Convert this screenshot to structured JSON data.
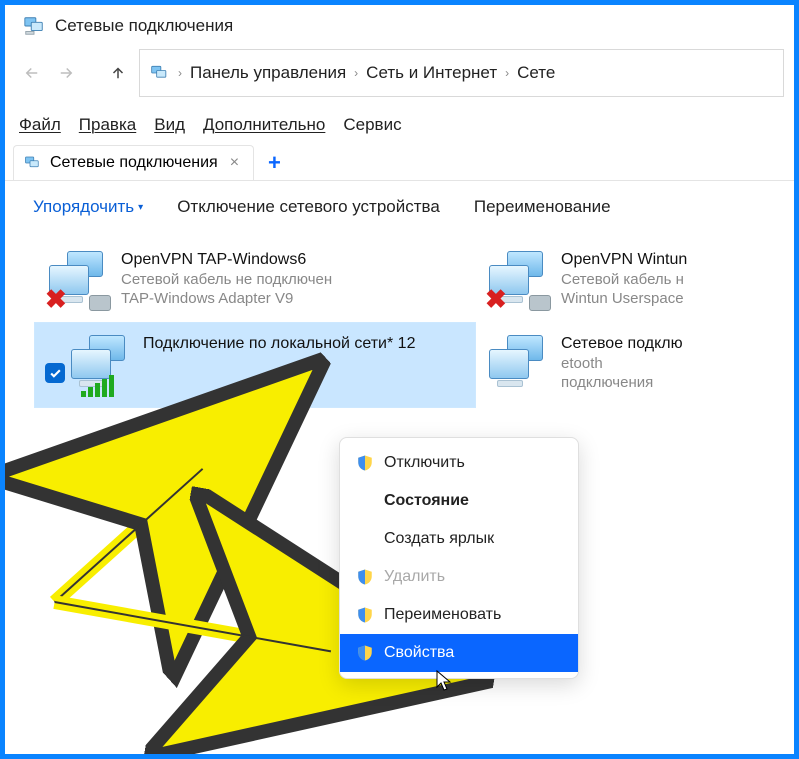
{
  "window": {
    "title": "Сетевые подключения"
  },
  "nav": {
    "breadcrumb": [
      "Панель управления",
      "Сеть и Интернет",
      "Сете"
    ]
  },
  "menubar": {
    "file": "Файл",
    "edit": "Правка",
    "view": "Вид",
    "extra": "Дополнительно",
    "service": "Сервис"
  },
  "tab": {
    "label": "Сетевые подключения"
  },
  "toolbar": {
    "organize": "Упорядочить",
    "disable": "Отключение сетевого устройства",
    "rename": "Переименование"
  },
  "connections": {
    "c1": {
      "name": "OpenVPN TAP-Windows6",
      "status": "Сетевой кабель не подключен",
      "adapter": "TAP-Windows Adapter V9"
    },
    "c2": {
      "name": "OpenVPN Wintun",
      "status": "Сетевой кабель н",
      "adapter": "Wintun Userspace"
    },
    "c3": {
      "name": "Подключение по локальной сети* 12",
      "status": "",
      "adapter": ""
    },
    "c4": {
      "name": "Сетевое подклю",
      "status": "etooth",
      "adapter": "подключения"
    }
  },
  "ctx": {
    "disable": "Отключить",
    "status": "Состояние",
    "shortcut": "Создать ярлык",
    "delete": "Удалить",
    "rename": "Переименовать",
    "properties": "Свойства"
  }
}
